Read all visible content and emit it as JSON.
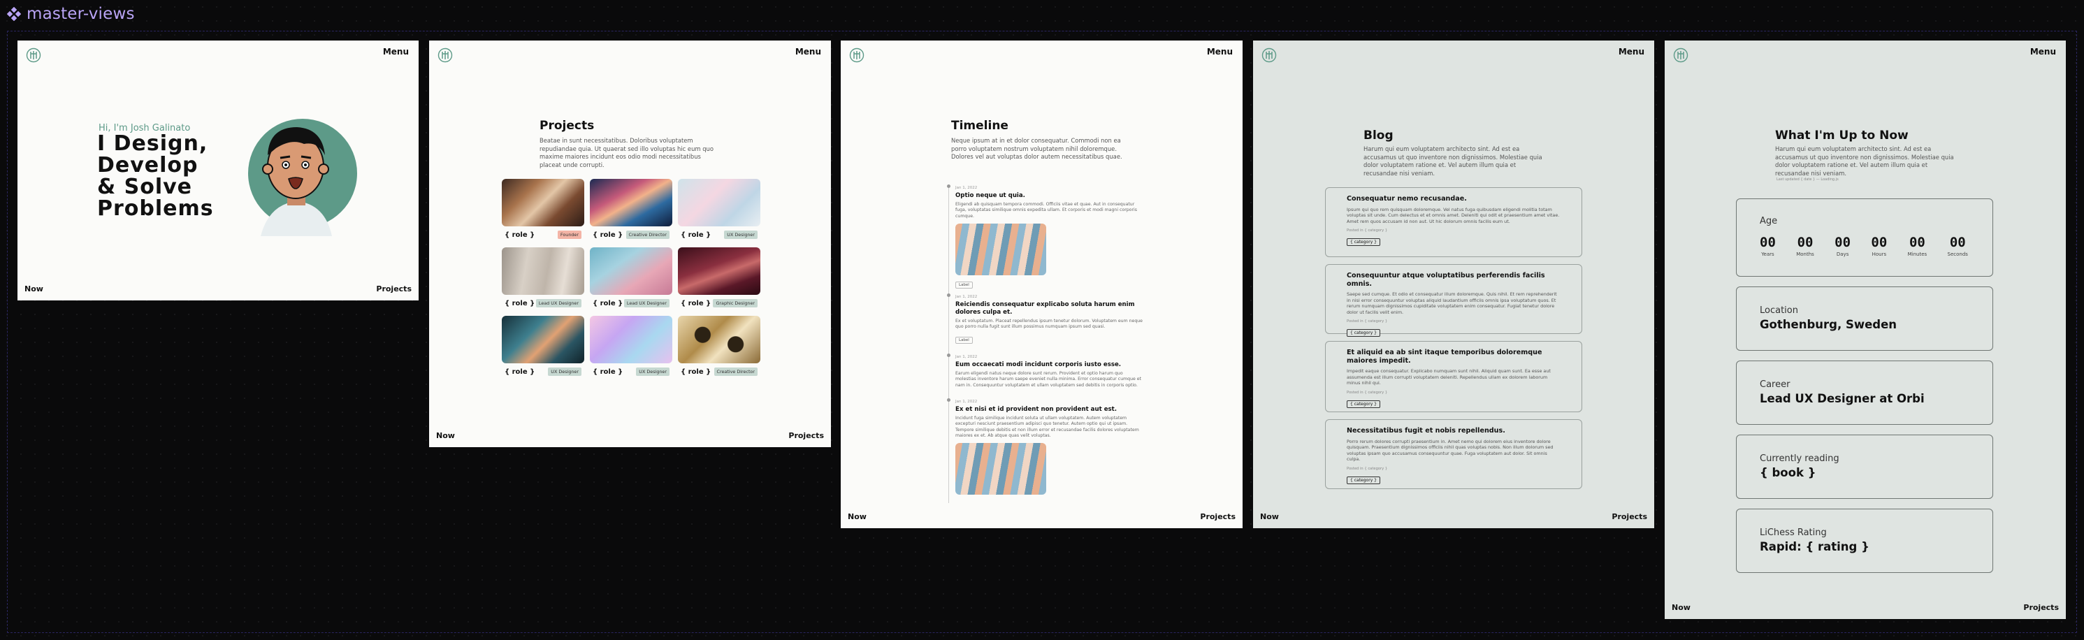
{
  "title": "master-views",
  "nav": {
    "menu": "Menu",
    "now": "Now",
    "projects": "Projects"
  },
  "home": {
    "greeting": "Hi, I'm Josh Galinato",
    "headline": "I Design,\nDevelop\n& Solve\nProblems"
  },
  "projects": {
    "title": "Projects",
    "intro": "Beatae in sunt necessitatibus. Doloribus voluptatem repudiandae quia. Ut quaerat sed illo voluptas hic eum quo maxime maiores incidunt eos odio modi necessitatibus placeat unde corrupti.",
    "items": [
      {
        "role": "{ role }",
        "tag": "Founder",
        "tag_color": "#f3b4a6"
      },
      {
        "role": "{ role }",
        "tag": "Creative Director",
        "tag_color": "#c6d8d1"
      },
      {
        "role": "{ role }",
        "tag": "UX Designer",
        "tag_color": "#c6d8d1"
      },
      {
        "role": "{ role }",
        "tag": "Lead UX Designer",
        "tag_color": "#c6d8d1"
      },
      {
        "role": "{ role }",
        "tag": "Lead UX Designer",
        "tag_color": "#c6d8d1"
      },
      {
        "role": "{ role }",
        "tag": "Graphic Designer",
        "tag_color": "#c6d8d1"
      },
      {
        "role": "{ role }",
        "tag": "UX Designer",
        "tag_color": "#c6d8d1"
      },
      {
        "role": "{ role }",
        "tag": "UX Designer",
        "tag_color": "#c6d8d1"
      },
      {
        "role": "{ role }",
        "tag": "Creative Director",
        "tag_color": "#c6d8d1"
      }
    ]
  },
  "timeline": {
    "title": "Timeline",
    "intro": "Neque ipsum at in et dolor consequatur. Commodi non ea porro voluptatem nostrum voluptatem nihil doloremque. Dolores vel aut voluptas dolor autem necessitatibus quae.",
    "items": [
      {
        "date": "Jan 1, 2022",
        "title": "Optio neque ut quia.",
        "body": "Eligendi ab quisquam tempora commodi. Officiis vitae et quae. Aut in consequatur fuga, voluptatas similique omnis expedita ullam. Et corporis et modi magni corporis cumque.",
        "button": "Label",
        "has_image": true
      },
      {
        "date": "Jan 1, 2022",
        "title": "Reiciendis consequatur explicabo soluta harum enim dolores culpa et.",
        "body": "Ex et voluptatum. Placeat repellendus ipsum tenetur dolorum. Voluptatem eum neque quo porro nulla fugit sunt illum possimus numquam ipsum sed quasi.",
        "button": "Label",
        "has_image": false
      },
      {
        "date": "Jan 1, 2022",
        "title": "Eum occaecati modi incidunt corporis iusto esse.",
        "body": "Earum eligendi natus neque dolore sunt rerum. Provident et optio harum quo molestias inventore harum saepe eveniet nulla minima. Error consequatur cumque et nam in. Consequuntur voluptatem et ullam voluptatem sed debitis in corporis optio.",
        "button": "",
        "has_image": false
      },
      {
        "date": "Jan 1, 2022",
        "title": "Ex et nisi et id provident non provident aut est.",
        "body": "Incidunt fuga similique incidunt soluta ut ullam voluptatem. Autem voluptatem excepturi nesciunt praesentium adipisci quo tenetur. Autem optio qui ut ipsam. Tempore similique debitis et non illum error et recusandae facilis dolores voluptatem maiores ex et. Ab atque quas velit voluptas.",
        "button": "",
        "has_image": true
      }
    ]
  },
  "blog": {
    "title": "Blog",
    "intro": "Harum qui eum voluptatem architecto sint. Ad est ea accusamus ut quo inventore non dignissimos. Molestiae quia dolor voluptatem ratione et. Vel autem illum quia et recusandae nisi veniam.",
    "posts": [
      {
        "title": "Consequatur nemo recusandae.",
        "body": "Ipsum qui quo rem quisquam doloremque. Vel natus fuga quibusdam eligendi molitia totam voluptas sit unde. Cum delectus et et omnis amet. Deleniti qui odit et praesentium amet vitae. Amet rem quos accusam id non aut. Ut hic dolorum omnis facilis eum ut.",
        "category": "Posted in { category }",
        "tag": "{ category }"
      },
      {
        "title": "Consequuntur atque voluptatibus perferendis facilis omnis.",
        "body": "Saepe sed cumque. Et odio et consequatur illum doloremque. Quis nihil. Et rem reprehenderit in nisi error consequuntur voluptas aliquid laudantium officiis omnis ipsa voluptatum quos. Et rerum numquam dignissimos cupiditate voluptatem enim consequatur. Fugiat tenetur dolore dolor ut facilis velit enim.",
        "category": "Posted in { category }",
        "tag": "{ category }"
      },
      {
        "title": "Et aliquid ea ab sint itaque temporibus doloremque maiores impedit.",
        "body": "Impedit eaque consequatur. Explicabo numquam sunt nihil. Aliquid quam sunt. Ea esse aut assumenda est illum corrupti voluptatem deleniti. Repellendus ullam ex dolorem laborum minus nihil qui.",
        "category": "Posted in { category }",
        "tag": "{ category }"
      },
      {
        "title": "Necessitatibus fugit et nobis repellendus.",
        "body": "Porro rerum dolores corrupti praesentium in. Amet nemo qui dolorem eius inventore dolore quisquam. Praesentium dignissimos officiis nihil quas voluptas nobis. Non illum dolorum sed voluptas ipsam quo accusamus consequuntur quae. Fuga voluptatem aut dolor. Sit omnis culpa.",
        "category": "Posted in { category }",
        "tag": "{ category }"
      }
    ]
  },
  "now": {
    "title": "What I'm Up to Now",
    "intro": "Harum qui eum voluptatem architecto sint. Ad est ea accusamus ut quo inventore non dignissimos. Molestiae quia dolor voluptatem ratione et. Vel autem illum quia et recusandae nisi veniam.",
    "updated": "Last updated { date } — Loading.js",
    "age_label": "Age",
    "timer": [
      {
        "value": "00",
        "unit": "Years"
      },
      {
        "value": "00",
        "unit": "Months"
      },
      {
        "value": "00",
        "unit": "Days"
      },
      {
        "value": "00",
        "unit": "Hours"
      },
      {
        "value": "00",
        "unit": "Minutes"
      },
      {
        "value": "00",
        "unit": "Seconds"
      }
    ],
    "location_label": "Location",
    "location": "Gothenburg, Sweden",
    "career_label": "Career",
    "career": "Lead UX Designer at Orbi",
    "reading_label": "Currently reading",
    "reading": "{ book }",
    "chess_label": "LiChess Rating",
    "chess": "Rapid: { rating }"
  },
  "colors": {
    "accent": "#5d9a88",
    "canvas": "#0a0a0b",
    "frame_light": "#fbfbf9",
    "frame_sage": "#dfe4e1",
    "title_purple": "#b9a4f5"
  }
}
